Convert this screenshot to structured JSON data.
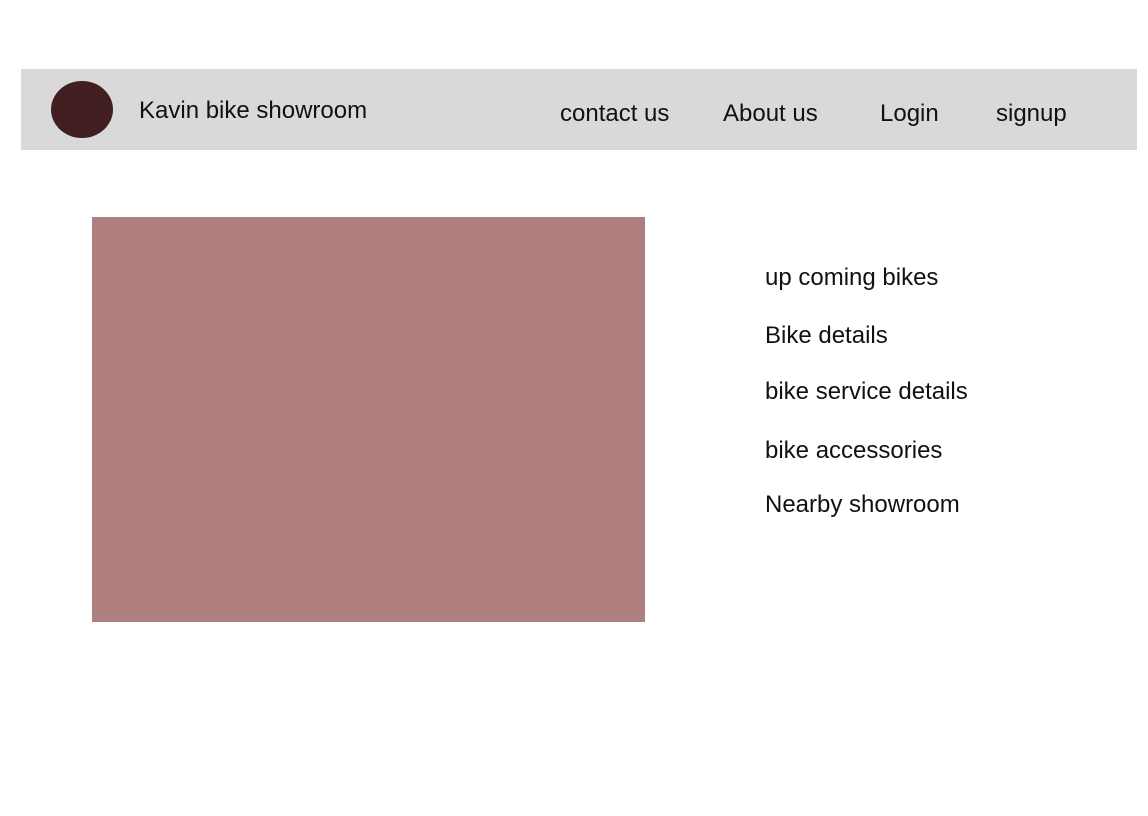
{
  "header": {
    "brand": "Kavin bike showroom",
    "nav": {
      "contact": "contact us",
      "about": "About us",
      "login": "Login",
      "signup": "signup"
    }
  },
  "side_menu": {
    "items": [
      "up coming bikes",
      "Bike details",
      "bike service details",
      "bike accessories",
      "Nearby showroom"
    ]
  },
  "colors": {
    "header_bg": "#d9d9d9",
    "logo": "#411f20",
    "hero_placeholder": "#af7f7f"
  }
}
